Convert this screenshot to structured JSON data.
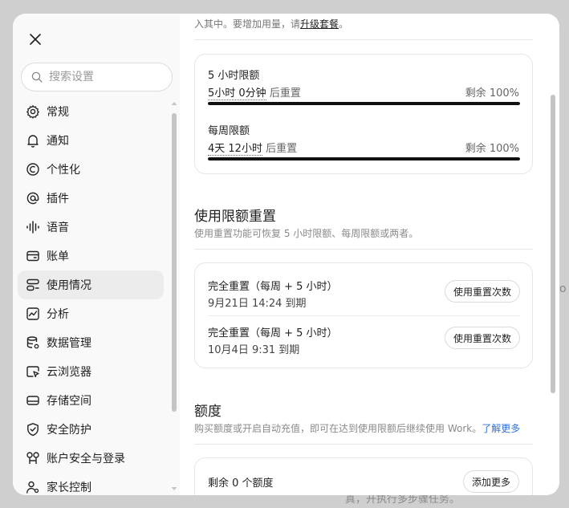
{
  "backdrop": {
    "bottom_text": "真，开执行多步骤任务。",
    "edge_text": "o"
  },
  "sidebar": {
    "search_placeholder": "搜索设置",
    "items": [
      {
        "label": "常规",
        "icon": "gear-icon"
      },
      {
        "label": "通知",
        "icon": "bell-icon"
      },
      {
        "label": "个性化",
        "icon": "personalize-icon"
      },
      {
        "label": "插件",
        "icon": "at-icon"
      },
      {
        "label": "语音",
        "icon": "waveform-icon"
      },
      {
        "label": "账单",
        "icon": "wallet-icon"
      },
      {
        "label": "使用情况",
        "icon": "usage-icon",
        "active": true
      },
      {
        "label": "分析",
        "icon": "chart-icon"
      },
      {
        "label": "数据管理",
        "icon": "database-gear-icon"
      },
      {
        "label": "云浏览器",
        "icon": "cloud-browser-icon"
      },
      {
        "label": "存储空间",
        "icon": "storage-icon"
      },
      {
        "label": "安全防护",
        "icon": "shield-icon"
      },
      {
        "label": "账户安全与登录",
        "icon": "key-icon"
      },
      {
        "label": "家长控制",
        "icon": "parental-icon"
      }
    ]
  },
  "main": {
    "top_note_prefix": "入其中。要增加用量，请",
    "top_note_link": "升级套餐",
    "top_note_suffix": "。",
    "limits": [
      {
        "title": "5 小时限额",
        "time": "5小时 0分钟",
        "after": "后重置",
        "remain_label": "剩余 100%",
        "progress": 1.0
      },
      {
        "title": "每周限额",
        "time": "4天 12小时",
        "after": "后重置",
        "remain_label": "剩余 100%",
        "progress": 1.0
      }
    ],
    "reset_section": {
      "title": "使用限额重置",
      "desc": "使用重置功能可恢复 5 小时限额、每周限额或两者。",
      "rows": [
        {
          "title": "完全重置（每周 + 5 小时）",
          "date": "9月21日 14:24 到期",
          "button": "使用重置次数"
        },
        {
          "title": "完全重置（每周 + 5 小时）",
          "date": "10月4日 9:31 到期",
          "button": "使用重置次数"
        }
      ]
    },
    "credits_section": {
      "title": "额度",
      "desc": "购买额度或开启自动充值，即可在达到使用限额后继续使用 Work。",
      "link": "了解更多",
      "remaining": "剩余 0 个额度",
      "button": "添加更多"
    }
  }
}
